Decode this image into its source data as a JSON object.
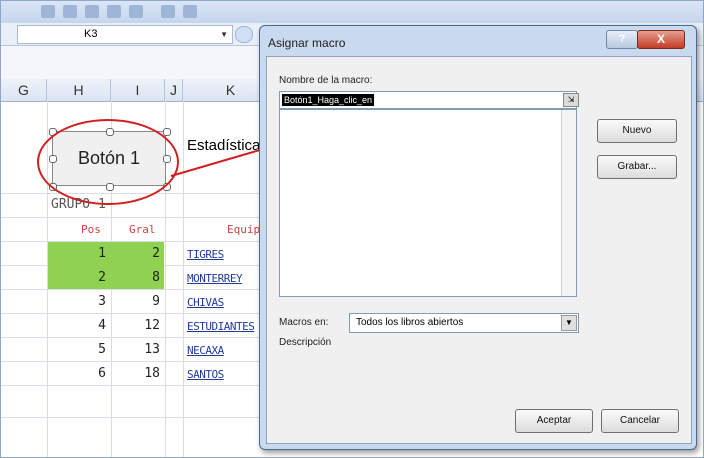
{
  "excel": {
    "namebox": "K3",
    "columns": [
      "G",
      "H",
      "I",
      "J",
      "K"
    ],
    "button_label": "Botón 1",
    "stat_label": "Estadística",
    "group_label": "GRUPO 1",
    "table_headers": [
      "Pos",
      "Gral",
      "Equipo"
    ],
    "rows": [
      {
        "pos": "1",
        "gral": "2",
        "team": "TIGRES"
      },
      {
        "pos": "2",
        "gral": "8",
        "team": "MONTERREY"
      },
      {
        "pos": "3",
        "gral": "9",
        "team": "CHIVAS"
      },
      {
        "pos": "4",
        "gral": "12",
        "team": "ESTUDIANTES"
      },
      {
        "pos": "5",
        "gral": "13",
        "team": "NECAXA"
      },
      {
        "pos": "6",
        "gral": "18",
        "team": "SANTOS"
      }
    ]
  },
  "dialog": {
    "title": "Asignar macro",
    "help": "?",
    "close": "X",
    "name_label": "Nombre de la macro:",
    "name_value": "Botón1_Haga_clic_en",
    "new_button": "Nuevo",
    "record_button": "Grabar...",
    "macros_in_label": "Macros en:",
    "macros_in_value": "Todos los libros abiertos",
    "description_label": "Descripción",
    "ok_button": "Aceptar",
    "cancel_button": "Cancelar"
  },
  "colors": {
    "highlight_green": "#8fd150",
    "annotation_red": "#d02020",
    "team_link": "#1f3b9c"
  }
}
